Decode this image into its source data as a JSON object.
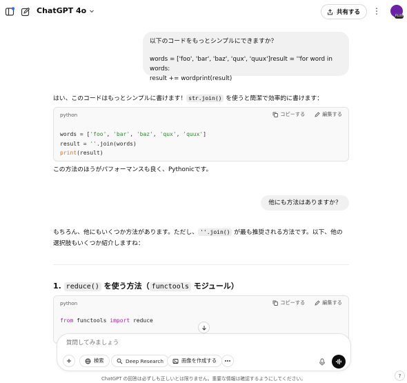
{
  "header": {
    "model_name": "ChatGPT 4o",
    "share_label": "共有する",
    "avatar_badge": "PLUS"
  },
  "messages": {
    "user1_line1": "以下のコードをもっとシンプルにできますか？",
    "user1_line2": "words = ['foo', 'bar', 'baz', 'qux', 'quux']result = ''for word in words:",
    "user1_line3": "result += wordprint(result)",
    "assistant1_pre": "はい、このコードはもっとシンプルに書けます！",
    "assistant1_code": "str.join()",
    "assistant1_post": " を使うと簡潔で効率的に書けます：",
    "codeblock1": {
      "lang": "python",
      "copy_label": "コピーする",
      "edit_label": "編集する",
      "line1_a": "words = [",
      "line1_s1": "'foo'",
      "line1_s2": "'bar'",
      "line1_s3": "'baz'",
      "line1_s4": "'qux'",
      "line1_s5": "'quux'",
      "line2_a": "result = ",
      "line2_s": "''",
      "line2_b": ".join(words)",
      "line3_fn": "print",
      "line3_b": "(result)"
    },
    "assistant1_after": "この方法のほうがパフォーマンスも良く、Pythonicです。",
    "user2": "他にも方法はありますか？",
    "assistant2_pre": "もちろん、他にもいくつか方法があります。ただし、",
    "assistant2_code": "''.join()",
    "assistant2_post": " が最も推奨される方法です。以下、他の",
    "assistant2_line2": "選択肢もいくつか紹介しますね：",
    "heading_num": "1. ",
    "heading_code1": "reduce()",
    "heading_mid": " を使う方法（",
    "heading_code2": "functools",
    "heading_end": " モジュール）",
    "codeblock2": {
      "lang": "python",
      "copy_label": "コピーする",
      "edit_label": "編集する",
      "kw1": "from",
      "mid": " functools ",
      "kw2": "import",
      "end": " reduce"
    }
  },
  "composer": {
    "placeholder": "質問してみましょう",
    "search_label": "検索",
    "deep_research_label": "Deep Research",
    "image_label": "画像を作成する"
  },
  "footer": {
    "disclaimer": "ChatGPT の回答は必ずしも正しいとは限りません。重要な情報は確認するようにしてください。",
    "help": "?"
  },
  "colors": {
    "string": "#2e8b2e",
    "keyword": "#a626a4",
    "function": "#c7752d",
    "avatar": "#6b21a8",
    "notification_dot": "#2f6fed"
  }
}
